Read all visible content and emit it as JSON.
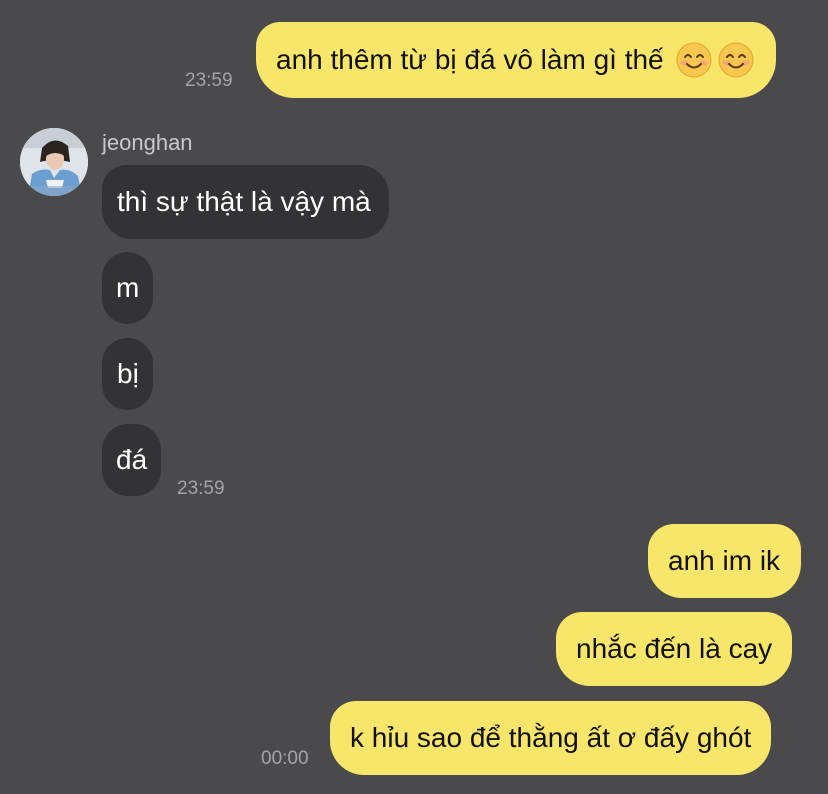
{
  "contact": {
    "name": "jeonghan"
  },
  "messages": {
    "m1": {
      "text": "anh thêm từ bị đá vô làm gì thế",
      "emoji_icons": [
        "smiling-face-icon",
        "smiling-face-icon"
      ],
      "time": "23:59"
    },
    "m2": {
      "text": "thì sự thật là vậy mà"
    },
    "m3": {
      "text": "m"
    },
    "m4": {
      "text": "bị"
    },
    "m5": {
      "text": "đá",
      "time": "23:59"
    },
    "m6": {
      "text": "anh im ik"
    },
    "m7": {
      "text": "nhắc đến là cay"
    },
    "m8": {
      "text": "k hỉu sao để thằng ất ơ đấy ghót",
      "time": "00:00"
    }
  },
  "colors": {
    "background": "#4a494c",
    "outgoing_bubble": "#f7e66a",
    "incoming_bubble": "#333235",
    "timestamp": "#a4a3a6"
  }
}
